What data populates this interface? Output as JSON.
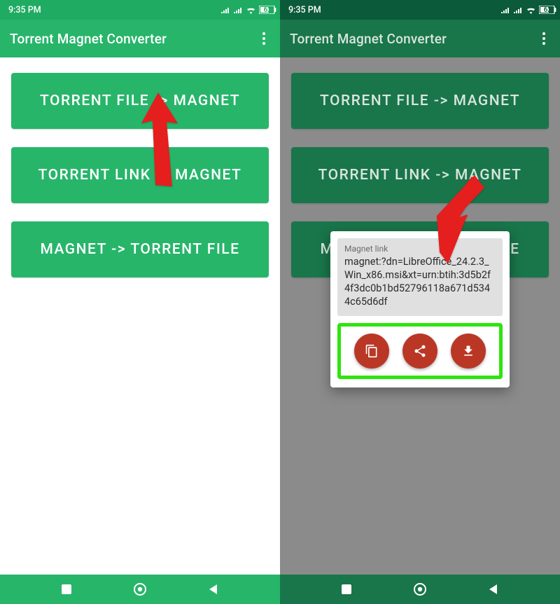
{
  "status": {
    "time": "9:35 PM",
    "battery": "62"
  },
  "app": {
    "title": "Torrent Magnet Converter"
  },
  "buttons": {
    "file_to_magnet": "TORRENT FILE -> MAGNET",
    "link_to_magnet": "TORRENT LINK -> MAGNET",
    "magnet_to_file": "MAGNET -> TORRENT FILE"
  },
  "dialog": {
    "label": "Magnet link",
    "magnet": "magnet:?dn=LibreOffice_24.2.3_Win_x86.msi&xt=urn:btih:3d5b2f4f3dc0b1bd52796118a671d5344c65d6df"
  },
  "colors": {
    "primary_left": "#27b56a",
    "primary_right_dim": "#19754a",
    "status_left": "#1fab62",
    "status_right": "#0b5a3a",
    "arrow": "#e51e1e",
    "highlight": "#2fe40d",
    "fab": "#ba3725"
  }
}
